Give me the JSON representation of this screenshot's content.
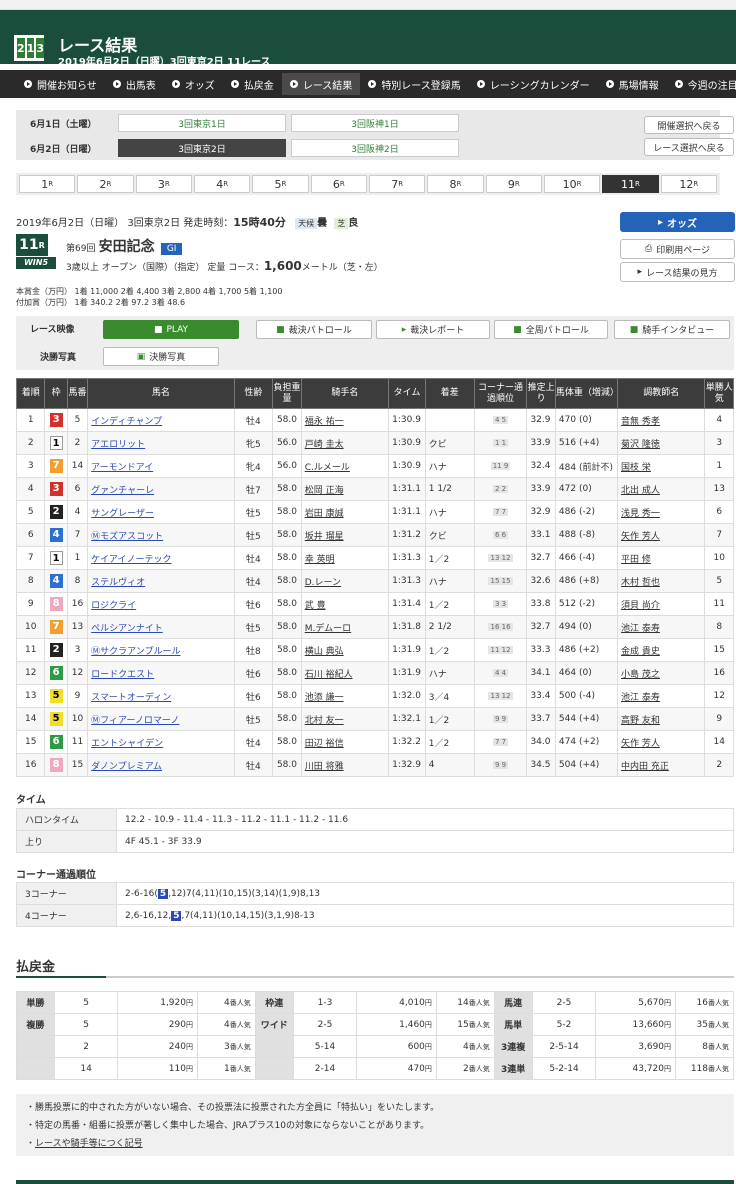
{
  "header": {
    "title": "レース結果",
    "subtitle": "2019年6月2日（日曜）3回東京2日 11レース",
    "logo": [
      "2",
      "1",
      "3"
    ]
  },
  "nav": [
    "開催お知らせ",
    "出馬表",
    "オッズ",
    "払戻金",
    "レース結果",
    "特別レース登録馬",
    "レーシングカレンダー",
    "馬場情報",
    "今週の注目レース"
  ],
  "dates": {
    "day1": "6月1日（土曜）",
    "day1_venues": [
      "3回東京1日",
      "3回阪神1日"
    ],
    "day2": "6月2日（日曜）",
    "day2_venues": [
      "3回東京2日",
      "3回阪神2日"
    ],
    "back1": "開催選択へ戻る",
    "back2": "レース選択へ戻る"
  },
  "races": [
    "1",
    "2",
    "3",
    "4",
    "5",
    "6",
    "7",
    "8",
    "9",
    "10",
    "11",
    "12"
  ],
  "race_unit": "R",
  "race": {
    "date": "2019年6月2日（日曜） 3回東京2日 発走時刻：",
    "time": "15時40分",
    "weather_lbl": "天候",
    "weather": "曇",
    "track_lbl": "芝",
    "track": "良",
    "num": "11",
    "num_unit": "R",
    "edition": "第69回",
    "name": "安田記念",
    "grade": "GⅠ",
    "cond": "3歳以上 オープン（国際）（指定） 定量 コース：",
    "dist": "1,600",
    "dist_unit": "メートル（芝・左）",
    "prize1": "本賞金（万円） 1着 11,000 2着 4,400 3着 2,800 4着 1,700 5着 1,100",
    "prize2": "付加賞（万円） 1着 340.2 2着 97.2 3着 48.6",
    "win5": "WIN5"
  },
  "side": {
    "odds": "オッズ",
    "print": "印刷用ページ",
    "guide": "レース結果の見方"
  },
  "media": {
    "video": "レース映像",
    "play": "PLAY",
    "photo": "決勝写真",
    "photo_btn": "決勝写真",
    "patrol": "裁決パトロール",
    "report": "裁決レポート",
    "full": "全周パトロール",
    "interview": "騎手インタビュー"
  },
  "cols": [
    "着順",
    "枠",
    "馬番",
    "馬名",
    "性齢",
    "負担重量",
    "騎手名",
    "タイム",
    "着差",
    "コーナー通過順位",
    "推定上り",
    "馬体重（増減）",
    "調教師名",
    "単勝人気"
  ],
  "rows": [
    [
      "1",
      "3",
      "5",
      "インディチャンプ",
      "牡4",
      "58.0",
      "福永 祐一",
      "1:30.9",
      "",
      "4 5",
      "32.9",
      "470 (0)",
      "音無 秀孝",
      "4"
    ],
    [
      "2",
      "1",
      "2",
      "アエロリット",
      "牝5",
      "56.0",
      "戸崎 圭太",
      "1:30.9",
      "クビ",
      "1 1",
      "33.9",
      "516 (+4)",
      "菊沢 隆徳",
      "3"
    ],
    [
      "3",
      "7",
      "14",
      "アーモンドアイ",
      "牝4",
      "56.0",
      "C.ルメール",
      "1:30.9",
      "ハナ",
      "11 9",
      "32.4",
      "484 (前計不)",
      "国枝 栄",
      "1"
    ],
    [
      "4",
      "3",
      "6",
      "グァンチャーレ",
      "牡7",
      "58.0",
      "松岡 正海",
      "1:31.1",
      "1 1/2",
      "2 2",
      "33.9",
      "472 (0)",
      "北出 成人",
      "13"
    ],
    [
      "5",
      "2",
      "4",
      "サングレーザー",
      "牡5",
      "58.0",
      "岩田 康誠",
      "1:31.1",
      "ハナ",
      "7 7",
      "32.9",
      "486 (-2)",
      "浅見 秀一",
      "6"
    ],
    [
      "6",
      "4",
      "7",
      "Ⓜモズアスコット",
      "牡5",
      "58.0",
      "坂井 瑠星",
      "1:31.2",
      "クビ",
      "6 6",
      "33.1",
      "488 (-8)",
      "矢作 芳人",
      "7"
    ],
    [
      "7",
      "1",
      "1",
      "ケイアイノーテック",
      "牡4",
      "58.0",
      "幸 英明",
      "1:31.3",
      "1／2",
      "13 12",
      "32.7",
      "466 (-4)",
      "平田 修",
      "10"
    ],
    [
      "8",
      "4",
      "8",
      "ステルヴィオ",
      "牡4",
      "58.0",
      "D.レーン",
      "1:31.3",
      "ハナ",
      "15 15",
      "32.6",
      "486 (+8)",
      "木村 哲也",
      "5"
    ],
    [
      "9",
      "8",
      "16",
      "ロジクライ",
      "牡6",
      "58.0",
      "武 豊",
      "1:31.4",
      "1／2",
      "3 3",
      "33.8",
      "512 (-2)",
      "須貝 尚介",
      "11"
    ],
    [
      "10",
      "7",
      "13",
      "ペルシアンナイト",
      "牡5",
      "58.0",
      "M.デムーロ",
      "1:31.8",
      "2 1/2",
      "16 16",
      "32.7",
      "494 (0)",
      "池江 泰寿",
      "8"
    ],
    [
      "11",
      "2",
      "3",
      "Ⓜサクラアンプルール",
      "牡8",
      "58.0",
      "横山 典弘",
      "1:31.9",
      "1／2",
      "11 12",
      "33.3",
      "486 (+2)",
      "金成 貴史",
      "15"
    ],
    [
      "12",
      "6",
      "12",
      "ロードクエスト",
      "牡6",
      "58.0",
      "石川 裕紀人",
      "1:31.9",
      "ハナ",
      "4 4",
      "34.1",
      "464 (0)",
      "小島 茂之",
      "16"
    ],
    [
      "13",
      "5",
      "9",
      "スマートオーディン",
      "牡6",
      "58.0",
      "池添 謙一",
      "1:32.0",
      "3／4",
      "13 12",
      "33.4",
      "500 (-4)",
      "池江 泰寿",
      "12"
    ],
    [
      "14",
      "5",
      "10",
      "Ⓜフィアーノロマーノ",
      "牡5",
      "58.0",
      "北村 友一",
      "1:32.1",
      "1／2",
      "9 9",
      "33.7",
      "544 (+4)",
      "高野 友和",
      "9"
    ],
    [
      "15",
      "6",
      "11",
      "エントシャイデン",
      "牡4",
      "58.0",
      "田辺 裕信",
      "1:32.2",
      "1／2",
      "7 7",
      "34.0",
      "474 (+2)",
      "矢作 芳人",
      "14"
    ],
    [
      "16",
      "8",
      "15",
      "ダノンプレミアム",
      "牡4",
      "58.0",
      "川田 将雅",
      "1:32.9",
      "4",
      "9 9",
      "34.5",
      "504 (+4)",
      "中内田 充正",
      "2"
    ]
  ],
  "waku_colors": {
    "1": "#ffffff",
    "2": "#222222",
    "3": "#d0312d",
    "4": "#2e6fd0",
    "5": "#f3dd2a",
    "6": "#2e9a44",
    "7": "#f0a030",
    "8": "#f0a8c0"
  },
  "time": {
    "h": "タイム",
    "halon_lbl": "ハロンタイム",
    "halon": "12.2 - 10.9 - 11.4 - 11.3 - 11.2 - 11.1 - 11.2 - 11.6",
    "agari_lbl": "上り",
    "agari": "4F 45.1 - 3F 33.9"
  },
  "corner": {
    "h": "コーナー通過順位",
    "c3_lbl": "3コーナー",
    "c3a": "2-6-16(",
    "c3b": "5",
    "c3c": ",12)7(4,11)(10,15)(3,14)(1,9)8,13",
    "c4_lbl": "4コーナー",
    "c4a": "2,6-16,12,",
    "c4b": "5",
    "c4c": ",7(4,11)(10,14,15)(3,1,9)8-13"
  },
  "pay": {
    "h": "払戻金",
    "yen": "円",
    "pop": "番人気",
    "rows": [
      [
        "単勝",
        "5",
        "1,920",
        "4",
        "枠連",
        "1-3",
        "4,010",
        "14",
        "馬連",
        "2-5",
        "5,670",
        "16"
      ],
      [
        "複勝",
        "5",
        "290",
        "4",
        "ワイド",
        "2-5",
        "1,460",
        "15",
        "馬単",
        "5-2",
        "13,660",
        "35"
      ],
      [
        "",
        "2",
        "240",
        "3",
        "",
        "5-14",
        "600",
        "4",
        "3連複",
        "2-5-14",
        "3,690",
        "8"
      ],
      [
        "",
        "14",
        "110",
        "1",
        "",
        "2-14",
        "470",
        "2",
        "3連単",
        "5-2-14",
        "43,720",
        "118"
      ]
    ]
  },
  "notes": [
    "勝馬投票に的中された方がいない場合、その投票法に投票された方全員に「特払い」をいたします。",
    "特定の馬番・組番に投票が著しく集中した場合、JRAプラス10の対象にならないことがあります。",
    "レースや騎手等につく記号"
  ]
}
